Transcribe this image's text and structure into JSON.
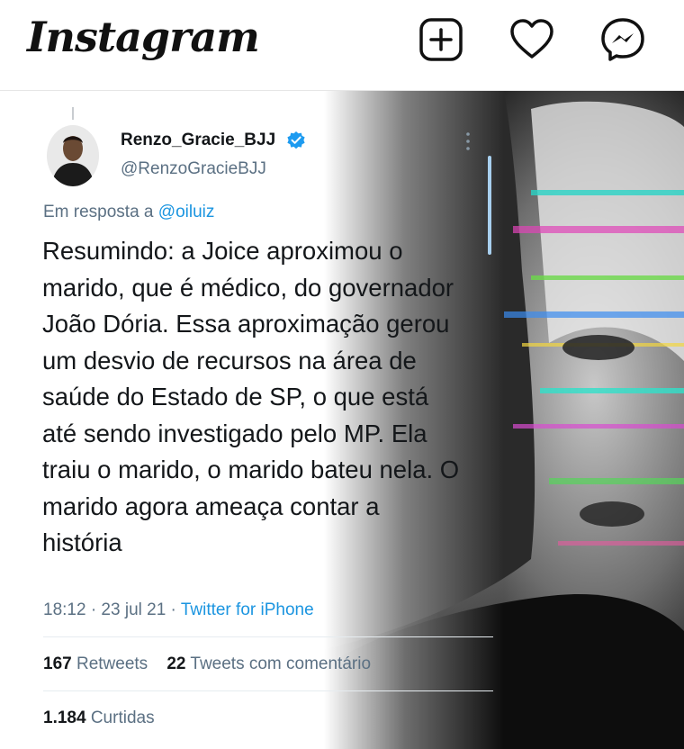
{
  "header": {
    "logo": "Instagram",
    "icons": [
      "new-post-icon",
      "heart-icon",
      "messenger-icon"
    ]
  },
  "tweet": {
    "display_name": "Renzo_Gracie_BJJ",
    "handle": "@RenzoGracieBJJ",
    "reply_prefix": "Em resposta a",
    "reply_to": "@oiluiz",
    "text": "Resumindo: a Joice aproximou o marido, que é médico, do governador João Dória. Essa aproximação gerou um desvio de recursos na área de saúde do Estado de SP, o que está até sendo investigado pelo MP. Ela traiu o marido, o marido bateu nela. O marido agora ameaça contar a história",
    "timestamp": "18:12 · 23 jul 21 ·",
    "source": "Twitter for iPhone",
    "retweets_count": "167",
    "retweets_label": "Retweets",
    "quote_count": "22",
    "quote_label": "Tweets com comentário",
    "likes_count": "1.184",
    "likes_label": "Curtidas"
  },
  "colors": {
    "link": "#1b95e0",
    "secondary_text": "#5b7083",
    "primary_text": "#14171a"
  }
}
